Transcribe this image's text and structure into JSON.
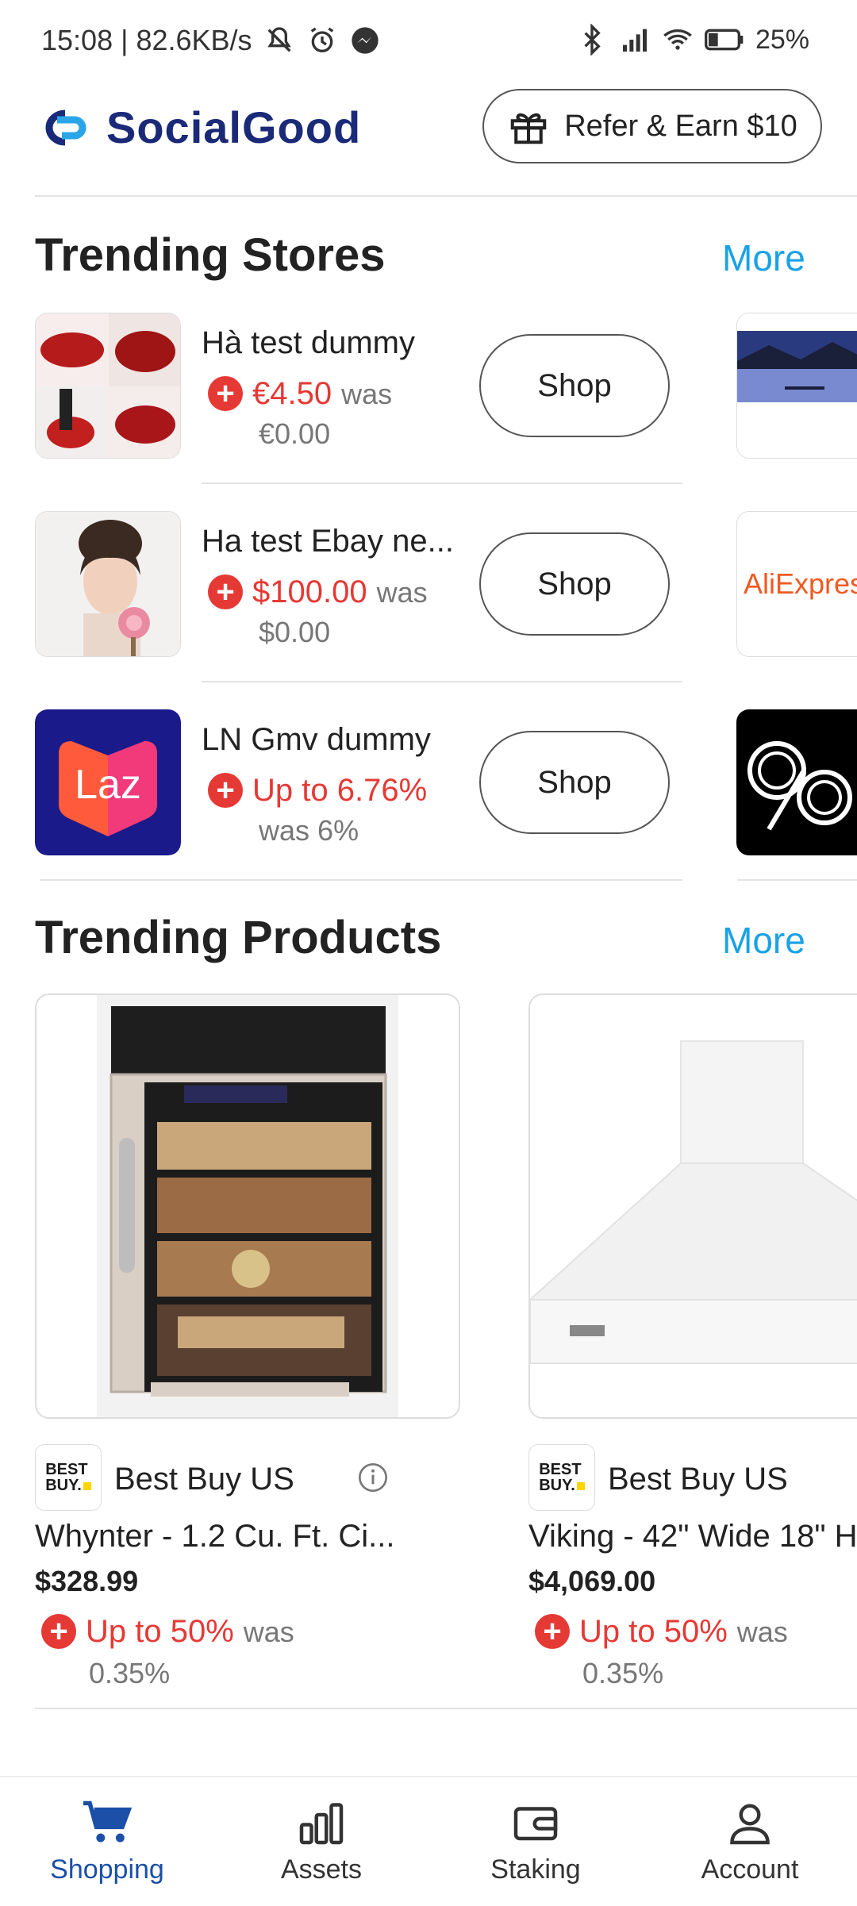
{
  "status_bar": {
    "time_speed": "15:08 | 82.6KB/s",
    "battery": "25%"
  },
  "header": {
    "brand": "SocialGood",
    "refer_button": "Refer & Earn $10"
  },
  "trending_stores": {
    "title": "Trending Stores",
    "more": "More",
    "items": [
      {
        "name": "Hà test dummy",
        "value": "€4.50",
        "was_label": "was",
        "was_value": "€0.00",
        "shop": "Shop"
      },
      {
        "name": "Ha test Ebay ne...",
        "value": "$100.00",
        "was_label": "was",
        "was_value": "$0.00",
        "shop": "Shop"
      },
      {
        "name": "LN Gmv dummy",
        "value": "Up to 6.76%",
        "was_label": "was",
        "was_value": "6%",
        "shop": "Shop"
      }
    ],
    "side_labels": [
      "AliExpress"
    ]
  },
  "trending_products": {
    "title": "Trending Products",
    "more": "More",
    "items": [
      {
        "merchant": "Best Buy US",
        "name": "Whynter - 1.2 Cu. Ft. Ci...",
        "price": "$328.99",
        "value": "Up to 50%",
        "was_label": "was",
        "was_value": "0.35%"
      },
      {
        "merchant": "Best Buy US",
        "name": "Viking - 42\" Wide 18\" H",
        "price": "$4,069.00",
        "value": "Up to 50%",
        "was_label": "was",
        "was_value": "0.35%"
      }
    ],
    "merchant_logo_text": [
      "BEST",
      "BUY."
    ]
  },
  "bottom_nav": {
    "items": [
      {
        "label": "Shopping",
        "icon": "cart-icon",
        "active": true
      },
      {
        "label": "Assets",
        "icon": "bar-chart-icon",
        "active": false
      },
      {
        "label": "Staking",
        "icon": "wallet-icon",
        "active": false
      },
      {
        "label": "Account",
        "icon": "person-icon",
        "active": false
      }
    ]
  },
  "colors": {
    "brand": "#1b2a78",
    "accent_link": "#1aa2e6",
    "cashback_red": "#e53935",
    "nav_active": "#1b4fa8"
  }
}
